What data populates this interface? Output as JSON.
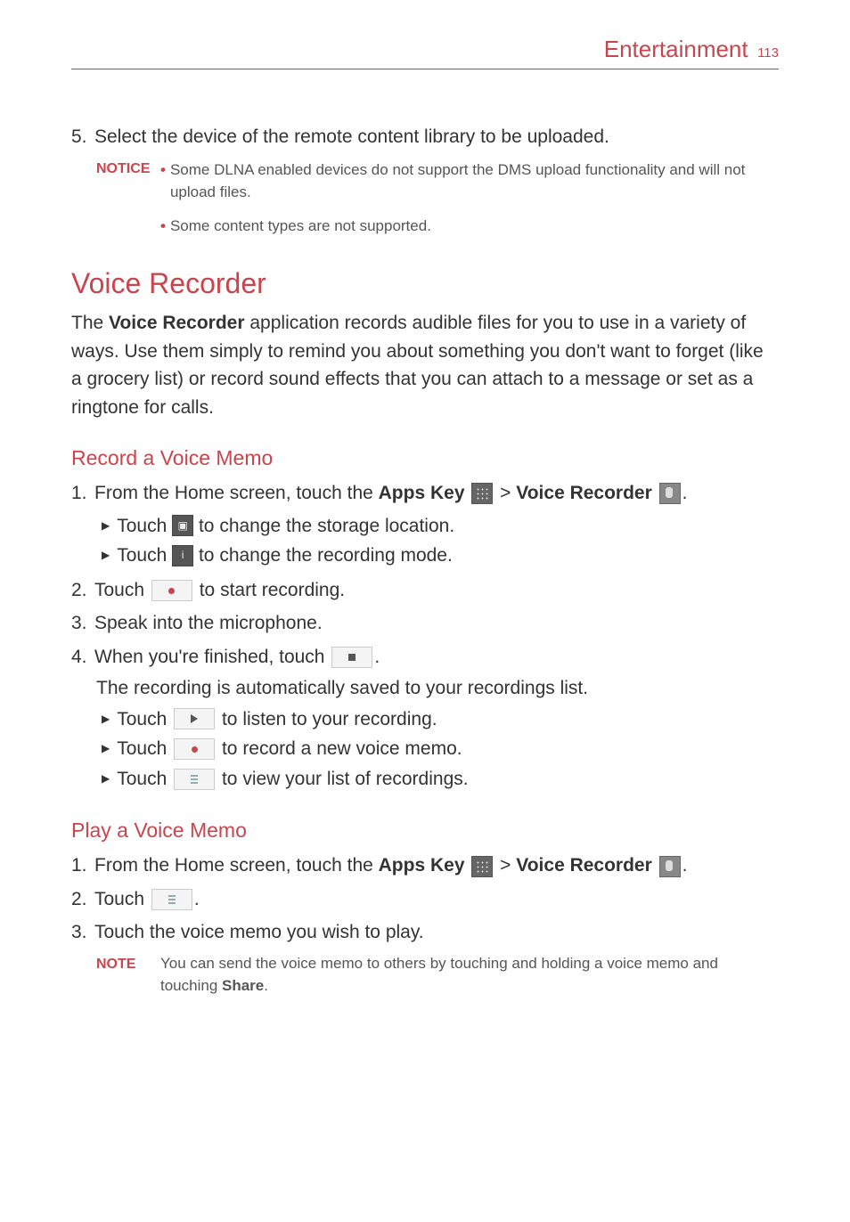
{
  "header": {
    "section": "Entertainment",
    "page_number": "113"
  },
  "top_step": {
    "num": "5.",
    "text": "Select the device of the remote content library to be uploaded."
  },
  "notice": {
    "label": "NOTICE",
    "items": [
      "Some DLNA enabled devices do not support the DMS upload functionality and will not upload files.",
      "Some content types are not supported."
    ]
  },
  "section_title": "Voice Recorder",
  "intro": {
    "prefix": "The ",
    "bold": "Voice Recorder",
    "rest": " application records audible files for you to use in a variety of ways. Use them simply to remind you about something you don't want to forget (like a grocery list) or record sound effects that you can attach to a message or set as a ringtone for calls."
  },
  "record_heading": "Record a Voice Memo",
  "record_steps": {
    "s1_num": "1.",
    "s1_a": "From the Home screen, touch the ",
    "s1_apps": "Apps Key",
    "s1_gt": " > ",
    "s1_vr": "Voice Recorder",
    "s1_period": ".",
    "s1_sub1_a": "Touch ",
    "s1_sub1_b": " to change the storage location.",
    "s1_sub2_a": "Touch ",
    "s1_sub2_b": " to change the recording mode.",
    "s2_num": "2.",
    "s2_a": "Touch ",
    "s2_b": " to start recording.",
    "s3_num": "3.",
    "s3_text": "Speak into the microphone.",
    "s4_num": "4.",
    "s4_a": "When you're finished, touch ",
    "s4_period": ".",
    "s4_cont": "The recording is automatically saved to your recordings list.",
    "s4_sub1_a": "Touch ",
    "s4_sub1_b": " to listen to your recording.",
    "s4_sub2_a": "Touch ",
    "s4_sub2_b": " to record a new voice memo.",
    "s4_sub3_a": "Touch ",
    "s4_sub3_b": " to view your list of recordings."
  },
  "play_heading": "Play a Voice Memo",
  "play_steps": {
    "s1_num": "1.",
    "s1_a": "From the Home screen, touch the ",
    "s1_apps": "Apps Key",
    "s1_gt": " > ",
    "s1_vr": "Voice Recorder",
    "s1_period": ".",
    "s2_num": "2.",
    "s2_a": "Touch ",
    "s2_period": ".",
    "s3_num": "3.",
    "s3_text": "Touch the voice memo you wish to play."
  },
  "note": {
    "label": "NOTE",
    "text_a": "You can send the voice memo to others by touching and holding a voice memo and touching ",
    "bold": "Share",
    "text_b": "."
  },
  "icons": {
    "storage": "▣",
    "info": "i"
  }
}
